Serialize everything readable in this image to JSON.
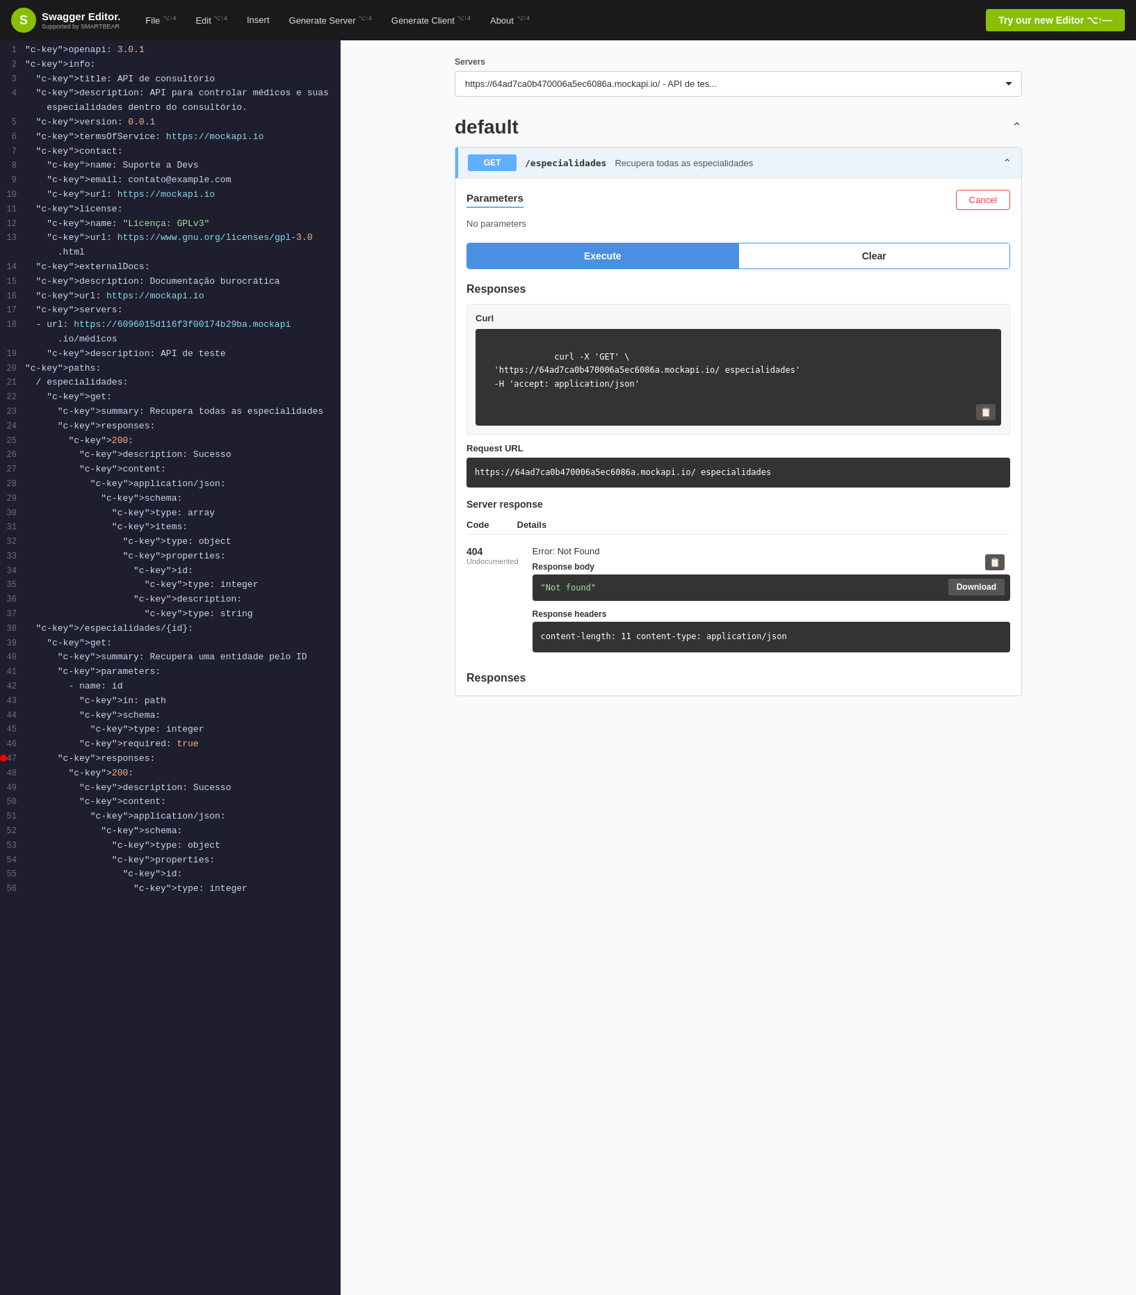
{
  "header": {
    "logo_text": "Swagger Editor.",
    "logo_sub": "Supported by SMARTBEAR",
    "nav": [
      {
        "label": "File",
        "shortcut": "⌥↑4"
      },
      {
        "label": "Edit",
        "shortcut": "⌥↑4"
      },
      {
        "label": "Insert",
        "shortcut": ""
      },
      {
        "label": "Generate Server",
        "shortcut": "⌥↑4"
      },
      {
        "label": "Generate Client",
        "shortcut": "⌥↑4"
      },
      {
        "label": "About",
        "shortcut": "⌥↑4"
      }
    ],
    "try_button": "Try our new Editor ⌥↑—"
  },
  "editor": {
    "lines": [
      {
        "num": 1,
        "content": "openapi: 3.0.1",
        "type": "normal"
      },
      {
        "num": 2,
        "content": "info:",
        "type": "key"
      },
      {
        "num": 3,
        "content": "  title: API de consultório",
        "type": "normal"
      },
      {
        "num": 4,
        "content": "  description: API para controlar médicos e suas\n    especialidades dentro do consultório.",
        "type": "normal"
      },
      {
        "num": 5,
        "content": "  version: 0.0.1",
        "type": "normal"
      },
      {
        "num": 6,
        "content": "  termsOfService: https://mockapi.io",
        "type": "normal"
      },
      {
        "num": 7,
        "content": "  contact:",
        "type": "normal"
      },
      {
        "num": 8,
        "content": "    name: Suporte a Devs",
        "type": "normal"
      },
      {
        "num": 9,
        "content": "    email: contato@example.com",
        "type": "normal"
      },
      {
        "num": 10,
        "content": "    url: https://mockapi.io",
        "type": "normal"
      },
      {
        "num": 11,
        "content": "  license:",
        "type": "normal"
      },
      {
        "num": 12,
        "content": "    name: \"Licença: GPLv3\"",
        "type": "normal"
      },
      {
        "num": 13,
        "content": "    url: https://www.gnu.org/licenses/gpl-3.0\n      .html",
        "type": "normal"
      },
      {
        "num": 14,
        "content": "  externalDocs:",
        "type": "key"
      },
      {
        "num": 15,
        "content": "  description: Documentação burocrática",
        "type": "normal"
      },
      {
        "num": 16,
        "content": "  url: https://mockapi.io",
        "type": "normal"
      },
      {
        "num": 17,
        "content": "  servers:",
        "type": "key"
      },
      {
        "num": 18,
        "content": "  - url: https://6096015d116f3f00174b29ba.mockapi\n      .io/médicos",
        "type": "normal"
      },
      {
        "num": 19,
        "content": "    description: API de teste",
        "type": "normal"
      },
      {
        "num": 20,
        "content": "paths:",
        "type": "key"
      },
      {
        "num": 21,
        "content": "  / especialidades:",
        "type": "path"
      },
      {
        "num": 22,
        "content": "    get:",
        "type": "key"
      },
      {
        "num": 23,
        "content": "      summary: Recupera todas as especialidades",
        "type": "normal"
      },
      {
        "num": 24,
        "content": "      responses:",
        "type": "key"
      },
      {
        "num": 25,
        "content": "        200:",
        "type": "num"
      },
      {
        "num": 26,
        "content": "          description: Sucesso",
        "type": "normal"
      },
      {
        "num": 27,
        "content": "          content:",
        "type": "normal"
      },
      {
        "num": 28,
        "content": "            application/json:",
        "type": "key"
      },
      {
        "num": 29,
        "content": "              schema:",
        "type": "normal"
      },
      {
        "num": 30,
        "content": "                type: array",
        "type": "normal"
      },
      {
        "num": 31,
        "content": "                items:",
        "type": "normal"
      },
      {
        "num": 32,
        "content": "                  type: object",
        "type": "normal"
      },
      {
        "num": 33,
        "content": "                  properties:",
        "type": "normal"
      },
      {
        "num": 34,
        "content": "                    id:",
        "type": "normal"
      },
      {
        "num": 35,
        "content": "                      type: integer",
        "type": "normal"
      },
      {
        "num": 36,
        "content": "                    description:",
        "type": "normal"
      },
      {
        "num": 37,
        "content": "                      type: string",
        "type": "normal"
      },
      {
        "num": 38,
        "content": "  /especialidades/{id}:",
        "type": "path"
      },
      {
        "num": 39,
        "content": "    get:",
        "type": "key"
      },
      {
        "num": 40,
        "content": "      summary: Recupera uma entidade pelo ID",
        "type": "normal"
      },
      {
        "num": 41,
        "content": "      parameters:",
        "type": "key"
      },
      {
        "num": 42,
        "content": "        - name: id",
        "type": "normal"
      },
      {
        "num": 43,
        "content": "          in: path",
        "type": "normal"
      },
      {
        "num": 44,
        "content": "          schema:",
        "type": "normal"
      },
      {
        "num": 45,
        "content": "            type: integer",
        "type": "normal"
      },
      {
        "num": 46,
        "content": "          required: true",
        "type": "normal"
      },
      {
        "num": 47,
        "content": "      responses:",
        "type": "key",
        "error": true
      },
      {
        "num": 48,
        "content": "        200:",
        "type": "num"
      },
      {
        "num": 49,
        "content": "          description: Sucesso",
        "type": "normal"
      },
      {
        "num": 50,
        "content": "          content:",
        "type": "normal"
      },
      {
        "num": 51,
        "content": "            application/json:",
        "type": "key"
      },
      {
        "num": 52,
        "content": "              schema:",
        "type": "normal"
      },
      {
        "num": 53,
        "content": "                type: object",
        "type": "normal"
      },
      {
        "num": 54,
        "content": "                properties:",
        "type": "normal"
      },
      {
        "num": 55,
        "content": "                  id:",
        "type": "normal"
      },
      {
        "num": 56,
        "content": "                    type: integer",
        "type": "normal"
      }
    ]
  },
  "swagger_ui": {
    "servers_label": "Servers",
    "servers_option": "https://64ad7ca0b470006a5ec6086a.mockapi.io/ - API de tes...",
    "default_section": "default",
    "endpoint": {
      "method": "GET",
      "path": "/\nespecia\nlidades",
      "description": "Recupera todas as especialidades",
      "parameters_tab": "Parameters",
      "cancel_button": "Cancel",
      "no_params": "No parameters",
      "execute_button": "Execute",
      "clear_button": "Clear"
    },
    "responses": {
      "label": "Responses",
      "curl_label": "Curl",
      "curl_code": "curl -X 'GET' \\\n  'https://64ad7ca0b470006a5ec6086a.mockapi.io/ especialidade\n  -H 'accept: application/json'",
      "request_url_label": "Request URL",
      "request_url_value": "https://64ad7ca0b470006a5ec6086a.mockapi.io/\nespecialidades",
      "server_response_label": "Server response",
      "code_header": "Code",
      "details_header": "Details",
      "response_code": "404",
      "response_undoc": "Undocumented",
      "response_error": "Error: Not Found",
      "response_body_label": "Response body",
      "response_body_value": "\"Not found\"",
      "download_button": "Download",
      "response_headers_label": "Response headers",
      "response_headers_value": "content-length: 11\ncontent-type: application/json",
      "responses_footer": "Responses"
    }
  }
}
